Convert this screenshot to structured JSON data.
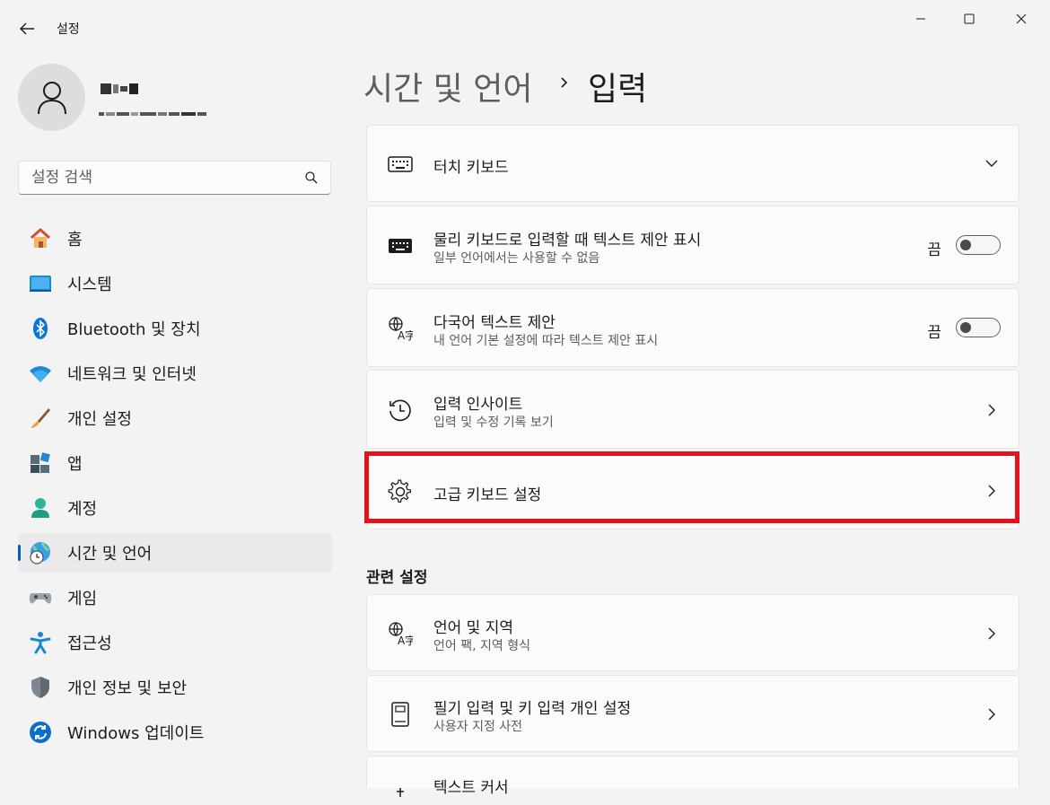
{
  "window": {
    "title": "설정",
    "back_icon": "back-arrow-icon",
    "minimize_icon": "minimize-icon",
    "maximize_icon": "maximize-icon",
    "close_icon": "close-icon"
  },
  "search": {
    "placeholder": "설정 검색",
    "icon": "search-icon"
  },
  "sidebar": {
    "items": [
      {
        "label": "홈",
        "icon": "home-icon"
      },
      {
        "label": "시스템",
        "icon": "system-icon"
      },
      {
        "label": "Bluetooth 및 장치",
        "icon": "bluetooth-icon"
      },
      {
        "label": "네트워크 및 인터넷",
        "icon": "wifi-icon"
      },
      {
        "label": "개인 설정",
        "icon": "brush-icon"
      },
      {
        "label": "앱",
        "icon": "apps-icon"
      },
      {
        "label": "계정",
        "icon": "account-icon"
      },
      {
        "label": "시간 및 언어",
        "icon": "globe-clock-icon",
        "active": true
      },
      {
        "label": "게임",
        "icon": "gamepad-icon"
      },
      {
        "label": "접근성",
        "icon": "accessibility-icon"
      },
      {
        "label": "개인 정보 및 보안",
        "icon": "shield-icon"
      },
      {
        "label": "Windows 업데이트",
        "icon": "update-icon"
      }
    ]
  },
  "header": {
    "parent": "시간 및 언어",
    "separator": "›",
    "current": "입력"
  },
  "main": {
    "cards": [
      {
        "title": "터치 키보드",
        "icon": "keyboard-outline-icon",
        "control": "expand"
      },
      {
        "title": "물리 키보드로 입력할 때 텍스트 제안 표시",
        "subtitle": "일부 언어에서는 사용할 수 없음",
        "icon": "keyboard-filled-icon",
        "control": "toggle",
        "state": "끔"
      },
      {
        "title": "다국어 텍스트 제안",
        "subtitle": "내 언어 기본 설정에 따라 텍스트 제안 표시",
        "icon": "language-icon",
        "control": "toggle",
        "state": "끔"
      },
      {
        "title": "입력 인사이트",
        "subtitle": "입력 및 수정 기록 보기",
        "icon": "history-icon",
        "control": "chevron"
      },
      {
        "title": "고급 키보드 설정",
        "icon": "gear-icon",
        "control": "chevron",
        "highlighted": true
      }
    ],
    "related_title": "관련 설정",
    "related_cards": [
      {
        "title": "언어 및 지역",
        "subtitle": "언어 팩, 지역 형식",
        "icon": "language-icon",
        "control": "chevron"
      },
      {
        "title": "필기 입력 및 키 입력 개인 설정",
        "subtitle": "사용자 지정 사전",
        "icon": "notebook-icon",
        "control": "chevron"
      },
      {
        "title": "텍스트 커서",
        "icon": "text-cursor-icon",
        "control": "chevron"
      }
    ]
  },
  "colors": {
    "accent": "#005fb8",
    "highlight_border": "#e3121f",
    "background": "#f3f3f3",
    "card": "#fbfbfb"
  }
}
